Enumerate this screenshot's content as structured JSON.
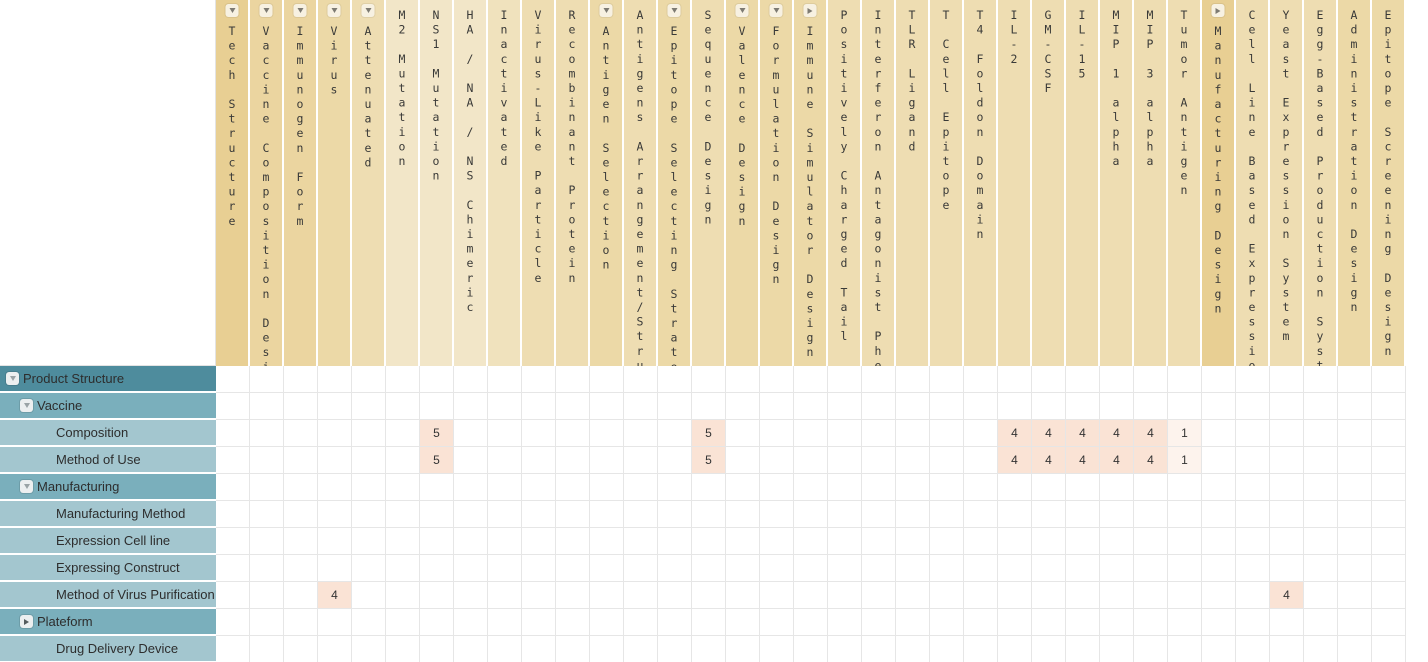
{
  "view": {
    "type": "patent-technology-matrix",
    "colors": {
      "column_header_dark": "#e8cf93",
      "column_header_mid": "#ecd9a4",
      "column_header_light": "#f2e6c8",
      "row_level1": "#4e8c9d",
      "row_level2": "#7aafbc",
      "row_level3": "#a3c6cf",
      "cell_value_high": "#fae3d5",
      "cell_value_low": "#fdf3ed",
      "grid_line": "#e6e6e6"
    }
  },
  "columns": [
    {
      "label": "Tech Structure",
      "toggle": "down",
      "level": 1,
      "shade": "dark"
    },
    {
      "label": "Vaccine Composition Design",
      "toggle": "down",
      "level": 2,
      "shade": "mid"
    },
    {
      "label": "Immunogen Form",
      "toggle": "down",
      "level": 3,
      "shade": "mid"
    },
    {
      "label": "Virus",
      "toggle": "down",
      "level": 4,
      "shade": "mid2"
    },
    {
      "label": "Attenuated",
      "toggle": "down",
      "level": 5,
      "shade": "mid3"
    },
    {
      "label": "M2 Mutation",
      "toggle": "none",
      "level": 6,
      "shade": "light"
    },
    {
      "label": "NS1 Mutation",
      "toggle": "none",
      "level": 6,
      "shade": "light"
    },
    {
      "label": "HA / NA / NS Chimeric",
      "toggle": "none",
      "level": 6,
      "shade": "light"
    },
    {
      "label": "Inactivated",
      "toggle": "none",
      "level": 5,
      "shade": "light2"
    },
    {
      "label": "Virus-Like Particle",
      "toggle": "none",
      "level": 4,
      "shade": "mid3"
    },
    {
      "label": "Recombinant Protein",
      "toggle": "none",
      "level": 4,
      "shade": "mid3"
    },
    {
      "label": "Antigen Selection",
      "toggle": "down",
      "level": 3,
      "shade": "mid2"
    },
    {
      "label": "Antigens Arrangement/Structure Design",
      "toggle": "none",
      "level": 3,
      "shade": "mid3"
    },
    {
      "label": "Epitope Selecting Strategy",
      "toggle": "down",
      "level": 3,
      "shade": "mid2"
    },
    {
      "label": "Sequence Design",
      "toggle": "none",
      "level": 3,
      "shade": "mid3"
    },
    {
      "label": "Valence Design",
      "toggle": "down",
      "level": 3,
      "shade": "mid2"
    },
    {
      "label": "Formulation Design",
      "toggle": "down",
      "level": 2,
      "shade": "mid2"
    },
    {
      "label": "Immune Simulator Design",
      "toggle": "right",
      "level": 2,
      "shade": "mid2"
    },
    {
      "label": "Positively Charged Tail",
      "toggle": "none",
      "level": 3,
      "shade": "mid3"
    },
    {
      "label": "Interferon Antagonist Phenotype Deficient",
      "toggle": "none",
      "level": 3,
      "shade": "mid3"
    },
    {
      "label": "TLR Ligand",
      "toggle": "none",
      "level": 3,
      "shade": "mid3"
    },
    {
      "label": "T Cell Epitope",
      "toggle": "none",
      "level": 3,
      "shade": "mid3"
    },
    {
      "label": "T4 Foldon Domain",
      "toggle": "none",
      "level": 3,
      "shade": "mid3"
    },
    {
      "label": "IL-2",
      "toggle": "none",
      "level": 3,
      "shade": "mid3"
    },
    {
      "label": "GM-CSF",
      "toggle": "none",
      "level": 3,
      "shade": "mid3"
    },
    {
      "label": "IL-15",
      "toggle": "none",
      "level": 3,
      "shade": "mid3"
    },
    {
      "label": "MIP 1 alpha",
      "toggle": "none",
      "level": 3,
      "shade": "mid3"
    },
    {
      "label": "MIP 3 alpha",
      "toggle": "none",
      "level": 3,
      "shade": "mid3"
    },
    {
      "label": "Tumor Antigen",
      "toggle": "none",
      "level": 3,
      "shade": "mid3"
    },
    {
      "label": "Manufacturing Design",
      "toggle": "right",
      "level": 1,
      "shade": "dark"
    },
    {
      "label": "Cell Line Based Expression System",
      "toggle": "none",
      "level": 2,
      "shade": "mid3"
    },
    {
      "label": "Yeast Expression System",
      "toggle": "none",
      "level": 2,
      "shade": "mid3"
    },
    {
      "label": "Egg-Based Production System",
      "toggle": "none",
      "level": 2,
      "shade": "mid3"
    },
    {
      "label": "Administration Design",
      "toggle": "none",
      "level": 1,
      "shade": "mid2"
    },
    {
      "label": "Epitope Screening Design",
      "toggle": "none",
      "level": 1,
      "shade": "mid2"
    }
  ],
  "rows": [
    {
      "label": "Product Structure",
      "level": 1,
      "indent": 1,
      "toggle": "down"
    },
    {
      "label": "Vaccine",
      "level": 2,
      "indent": 2,
      "toggle": "down"
    },
    {
      "label": "Composition",
      "level": 3,
      "indent": 3,
      "toggle": "none"
    },
    {
      "label": "Method of Use",
      "level": 3,
      "indent": 3,
      "toggle": "none"
    },
    {
      "label": "Manufacturing",
      "level": 2,
      "indent": 2,
      "toggle": "down"
    },
    {
      "label": "Manufacturing Method",
      "level": 3,
      "indent": 3,
      "toggle": "none"
    },
    {
      "label": "Expression Cell line",
      "level": 3,
      "indent": 3,
      "toggle": "none"
    },
    {
      "label": "Expressing Construct",
      "level": 3,
      "indent": 3,
      "toggle": "none"
    },
    {
      "label": "Method of Virus Purification",
      "level": 3,
      "indent": 3,
      "toggle": "none"
    },
    {
      "label": "Plateform",
      "level": 2,
      "indent": 2,
      "toggle": "right"
    },
    {
      "label": "Drug Delivery Device",
      "level": 3,
      "indent": 3,
      "toggle": "none"
    }
  ],
  "cells": [
    {
      "row": 2,
      "col": 6,
      "value": "5"
    },
    {
      "row": 2,
      "col": 14,
      "value": "5"
    },
    {
      "row": 2,
      "col": 23,
      "value": "4"
    },
    {
      "row": 2,
      "col": 24,
      "value": "4"
    },
    {
      "row": 2,
      "col": 25,
      "value": "4"
    },
    {
      "row": 2,
      "col": 26,
      "value": "4"
    },
    {
      "row": 2,
      "col": 27,
      "value": "4"
    },
    {
      "row": 2,
      "col": 28,
      "value": "1"
    },
    {
      "row": 3,
      "col": 6,
      "value": "5"
    },
    {
      "row": 3,
      "col": 14,
      "value": "5"
    },
    {
      "row": 3,
      "col": 23,
      "value": "4"
    },
    {
      "row": 3,
      "col": 24,
      "value": "4"
    },
    {
      "row": 3,
      "col": 25,
      "value": "4"
    },
    {
      "row": 3,
      "col": 26,
      "value": "4"
    },
    {
      "row": 3,
      "col": 27,
      "value": "4"
    },
    {
      "row": 3,
      "col": 28,
      "value": "1"
    },
    {
      "row": 8,
      "col": 3,
      "value": "4"
    },
    {
      "row": 8,
      "col": 31,
      "value": "4"
    }
  ]
}
